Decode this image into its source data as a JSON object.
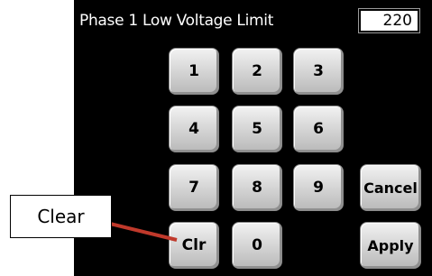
{
  "header": {
    "title": "Phase 1 Low Voltage Limit",
    "value": "220"
  },
  "keypad": {
    "k1": "1",
    "k2": "2",
    "k3": "3",
    "k4": "4",
    "k5": "5",
    "k6": "6",
    "k7": "7",
    "k8": "8",
    "k9": "9",
    "clr": "Clr",
    "k0": "0",
    "cancel": "Cancel",
    "apply": "Apply"
  },
  "annotation": {
    "label": "Clear",
    "line_color": "#c0392b"
  }
}
